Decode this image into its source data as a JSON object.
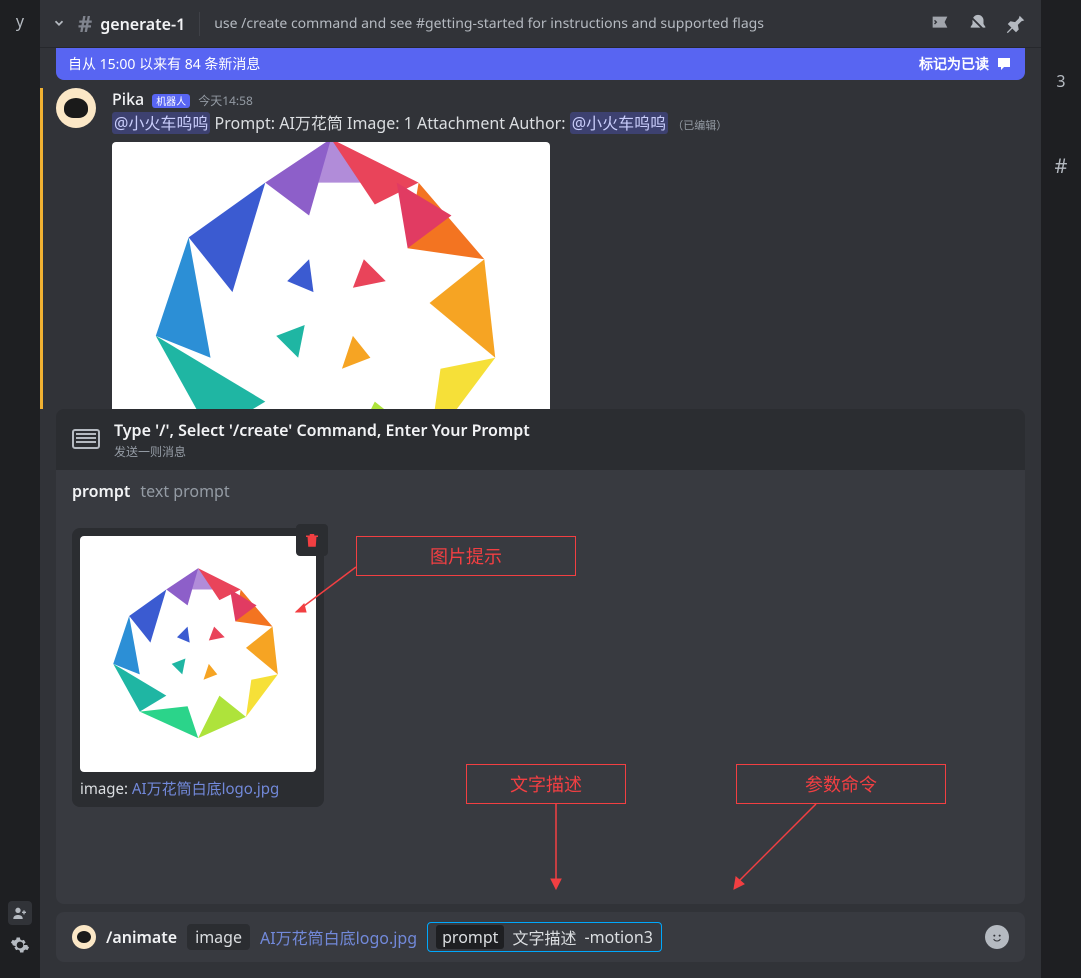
{
  "header": {
    "channel": "generate-1",
    "topic": "use /create command and see #getting-started for instructions and supported flags"
  },
  "newMessages": {
    "text": "自从 15:00 以来有 84 条新消息",
    "mark": "标记为已读"
  },
  "message": {
    "user": "Pika",
    "botTag": "机器人",
    "time": "今天14:58",
    "mention1": "@小火车呜呜",
    "promptLabel": " Prompt: ",
    "promptText": "AI万花筒",
    "imageLabel": "  Image: 1 Attachment  Author: ",
    "mention2": "@小火车呜呜",
    "edited": "（已编辑）"
  },
  "reply": {
    "title": "Type '/', Select '/create' Command, Enter Your Prompt",
    "sub": "发送一则消息"
  },
  "promptRow": {
    "key": "prompt",
    "val": "text prompt"
  },
  "upload": {
    "label": "image: ",
    "filename": "AI万花筒白底logo.jpg"
  },
  "annotations": {
    "a1": "图片提示",
    "a2": "文字描述",
    "a3": "参数命令"
  },
  "input": {
    "cmd": "/animate",
    "chipKey": "image",
    "chipVal": "AI万花筒白底logo.jpg",
    "p2key": "prompt",
    "p2mid": "文字描述",
    "p2end": "-motion3"
  },
  "right": {
    "num": "3",
    "hash": "#"
  },
  "sidebar": {
    "letter": "y"
  }
}
